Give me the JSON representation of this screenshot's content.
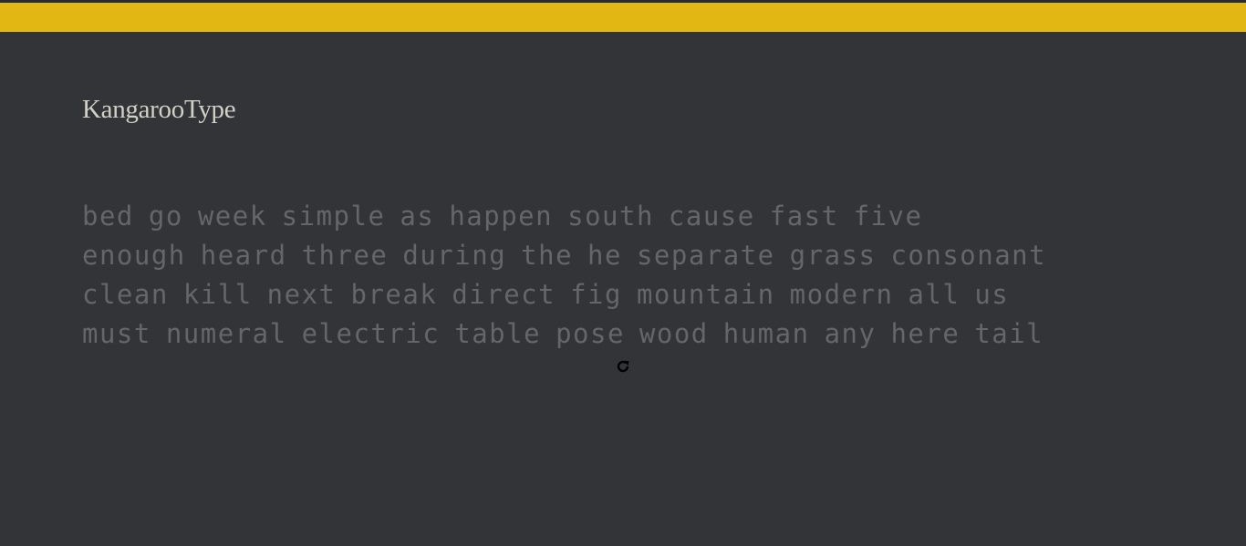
{
  "app": {
    "title": "KangarooType",
    "accent_color": "#e2b714",
    "background_color": "#323437",
    "text_color": "#646669"
  },
  "test": {
    "lines": [
      [
        "bed",
        "go",
        "week",
        "simple",
        "as",
        "happen",
        "south",
        "cause",
        "fast",
        "five"
      ],
      [
        "enough",
        "heard",
        "three",
        "during",
        "the",
        "he",
        "separate",
        "grass",
        "consonant"
      ],
      [
        "clean",
        "kill",
        "next",
        "break",
        "direct",
        "fig",
        "mountain",
        "modern",
        "all",
        "us"
      ],
      [
        "must",
        "numeral",
        "electric",
        "table",
        "pose",
        "wood",
        "human",
        "any",
        "here",
        "tail"
      ]
    ]
  },
  "controls": {
    "restart_icon": "restart-icon"
  }
}
